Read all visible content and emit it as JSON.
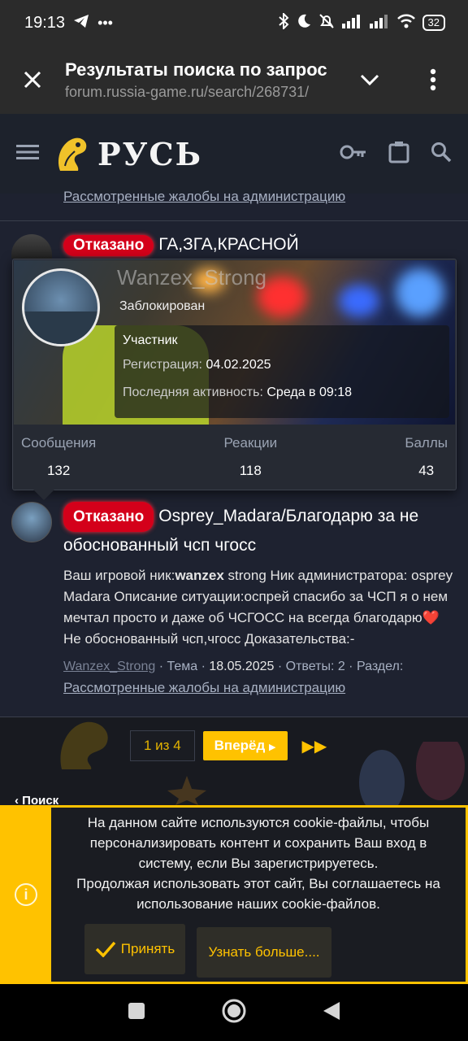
{
  "status_bar": {
    "time": "19:13",
    "battery": "32"
  },
  "browser": {
    "title": "Результаты поиска по запрос",
    "url": "forum.russia-game.ru/search/268731/"
  },
  "site": {
    "logo_text": "РУСЬ"
  },
  "previous_result": {
    "section_link": "Рассмотренные жалобы на администрацию"
  },
  "result1": {
    "badge": "Отказано",
    "title": "ГА,ЗГА,КРАСНОЙ"
  },
  "member_card": {
    "name": "Wanzex_Strong",
    "status": "Заблокирован",
    "role": "Участник",
    "reg_label": "Регистрация:",
    "reg_value": "04.02.2025",
    "activity_label": "Последняя активность:",
    "activity_value": "Среда в 09:18",
    "stats": [
      {
        "label": "Сообщения",
        "value": "132"
      },
      {
        "label": "Реакции",
        "value": "118"
      },
      {
        "label": "Баллы",
        "value": "43"
      }
    ]
  },
  "result2": {
    "badge": "Отказано",
    "title": "Osprey_Madara/Благодарю за не обоснованный чсп чгосс",
    "body_prefix": "Ваш игровой ник:",
    "body_bold": "wanzex",
    "body_rest": " strong Ник администратора: osprey Madara Описание ситуации:оспрей спасибо за ЧСП я о нем мечтал просто и даже об ЧСГОСС на всегда благодарю",
    "body_emoji": "❤️",
    "body_end": " Не обоснованный чсп,чгосс Доказательства:-",
    "author": "Wanzex_Strong",
    "meta_type": " · Тема · ",
    "date": "18.05.2025",
    "meta_rest": " · Ответы: 2 · Раздел:",
    "section": "Рассмотренные жалобы на администрацию"
  },
  "pagination": {
    "page": "1 из 4",
    "next": "Вперёд",
    "breadcrumb": "Поиск"
  },
  "cookie": {
    "text1": "На данном сайте используются cookie-файлы, чтобы персонализировать контент и сохранить Ваш вход в систему, если Вы зарегистрируетесь.",
    "text2": "Продолжая использовать этот сайт, Вы соглашаетесь на использование наших cookie-файлов.",
    "accept": "Принять",
    "more": "Узнать больше...."
  },
  "colors": {
    "accent": "#ffc200",
    "badge": "#d4001a",
    "background": "#1e2230"
  }
}
